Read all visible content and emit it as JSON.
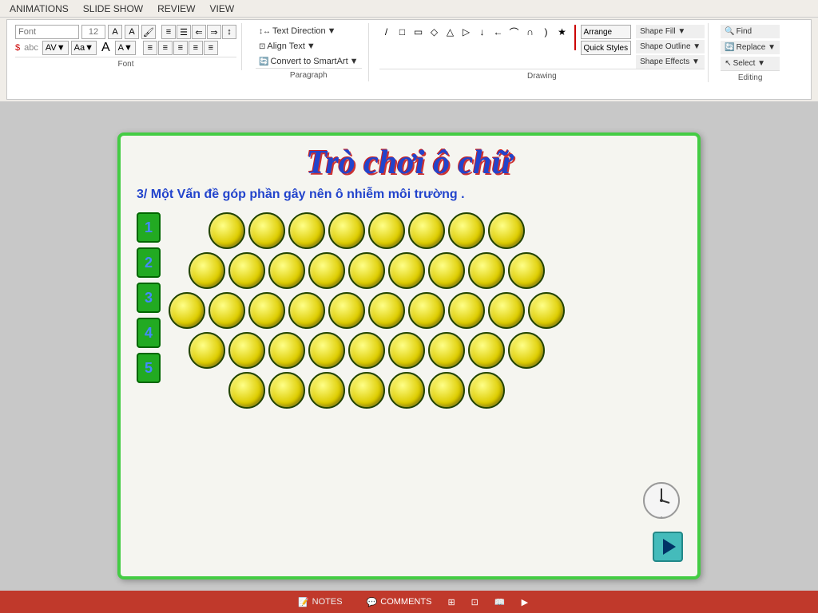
{
  "menu": {
    "items": [
      "ANIMATIONS",
      "SLIDE SHOW",
      "REVIEW",
      "VIEW"
    ]
  },
  "ribbon": {
    "groups": {
      "font": {
        "label": "Font",
        "font_name": "",
        "font_size": ""
      },
      "paragraph": {
        "label": "Paragraph",
        "text_direction": "Text Direction",
        "align_text": "Align Text",
        "align_text_arrow": "▼",
        "convert": "Convert to SmartArt"
      },
      "drawing": {
        "label": "Drawing",
        "arrange": "Arrange",
        "quick_styles": "Quick\nStyles",
        "shape_fill": "Shape Fill ▼",
        "shape_outline": "Shape Outline ▼",
        "shape_effects": "Shape Effects ▼"
      },
      "editing": {
        "label": "Editing",
        "find": "Find",
        "replace": "Replace ▼",
        "select": "Select ▼"
      }
    }
  },
  "slide": {
    "title": "Trò chơi ô chữ",
    "subtitle": "3/ Một Vấn đề góp phần gây nên ô nhiễm môi trường .",
    "row_labels": [
      "1",
      "2",
      "3",
      "4",
      "5"
    ],
    "rows": [
      {
        "count": 8,
        "offset": 1
      },
      {
        "count": 9,
        "offset": 0
      },
      {
        "count": 10,
        "offset": 0
      },
      {
        "count": 9,
        "offset": 0
      },
      {
        "count": 7,
        "offset": 1
      }
    ]
  },
  "status_bar": {
    "notes": "NOTES",
    "comments": "COMMENTS"
  }
}
